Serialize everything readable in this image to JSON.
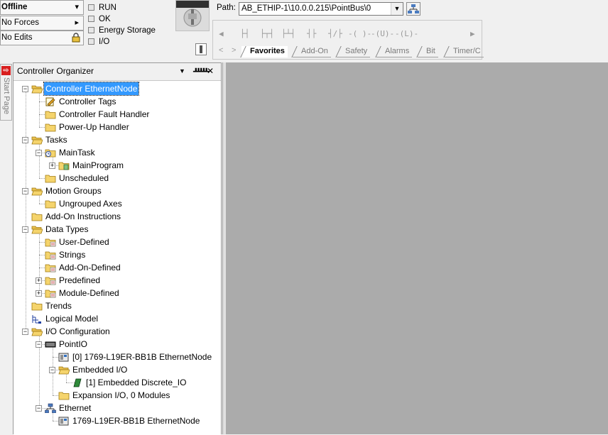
{
  "status": {
    "mode": "Offline",
    "forces": "No Forces",
    "edits": "No Edits",
    "mode_arrow": "▾",
    "forces_arrow": "▸"
  },
  "controller_status": [
    "RUN",
    "OK",
    "Energy Storage",
    "I/O"
  ],
  "path": {
    "label": "Path:",
    "value": "AB_ETHIP-1\\10.0.0.215\\PointBus\\0"
  },
  "ladder_elements": [
    "├┤",
    "├┬┤",
    "├┴┤",
    "┤├",
    "┤/├",
    "-( )-",
    "-(U)-",
    "-(L)-"
  ],
  "instruction_tabs": [
    "Favorites",
    "Add-On",
    "Safety",
    "Alarms",
    "Bit",
    "Timer/C"
  ],
  "start_page": {
    "label": "Start Page"
  },
  "organizer": {
    "title": "Controller Organizer",
    "pin": "▼",
    "dock": "ꟷ",
    "close": "✕",
    "tree": [
      {
        "label": "Controller EthernetNode",
        "icon": "folder-open-icon",
        "selected": true
      },
      {
        "label": "Controller Tags",
        "icon": "tags-icon"
      },
      {
        "label": "Controller Fault Handler",
        "icon": "folder-icon"
      },
      {
        "label": "Power-Up Handler",
        "icon": "folder-icon"
      },
      {
        "label": "Tasks",
        "icon": "folder-open-icon"
      },
      {
        "label": "MainTask",
        "icon": "task-icon"
      },
      {
        "label": "MainProgram",
        "icon": "program-icon"
      },
      {
        "label": "Unscheduled",
        "icon": "folder-icon"
      },
      {
        "label": "Motion Groups",
        "icon": "folder-open-icon"
      },
      {
        "label": "Ungrouped Axes",
        "icon": "folder-icon"
      },
      {
        "label": "Add-On Instructions",
        "icon": "folder-icon"
      },
      {
        "label": "Data Types",
        "icon": "folder-open-icon"
      },
      {
        "label": "User-Defined",
        "icon": "datatype-folder-icon"
      },
      {
        "label": "Strings",
        "icon": "datatype-folder-icon"
      },
      {
        "label": "Add-On-Defined",
        "icon": "datatype-folder-icon"
      },
      {
        "label": "Predefined",
        "icon": "datatype-folder-icon"
      },
      {
        "label": "Module-Defined",
        "icon": "datatype-folder-icon"
      },
      {
        "label": "Trends",
        "icon": "folder-icon"
      },
      {
        "label": "Logical Model",
        "icon": "logical-model-icon"
      },
      {
        "label": "I/O Configuration",
        "icon": "folder-open-icon"
      },
      {
        "label": "PointIO",
        "icon": "backplane-icon"
      },
      {
        "label": "[0] 1769-L19ER-BB1B EthernetNode",
        "icon": "controller-module-icon"
      },
      {
        "label": "Embedded I/O",
        "icon": "folder-open-icon"
      },
      {
        "label": "[1] Embedded Discrete_IO",
        "icon": "io-module-icon"
      },
      {
        "label": "Expansion I/O, 0 Modules",
        "icon": "folder-icon"
      },
      {
        "label": "Ethernet",
        "icon": "network-icon"
      },
      {
        "label": "1769-L19ER-BB1B EthernetNode",
        "icon": "controller-module-icon"
      }
    ]
  },
  "colors": {
    "selection": "#3399ff",
    "folder": "#f5d46c",
    "workspace": "#ababab",
    "start_page_red": "#d81e1e"
  }
}
